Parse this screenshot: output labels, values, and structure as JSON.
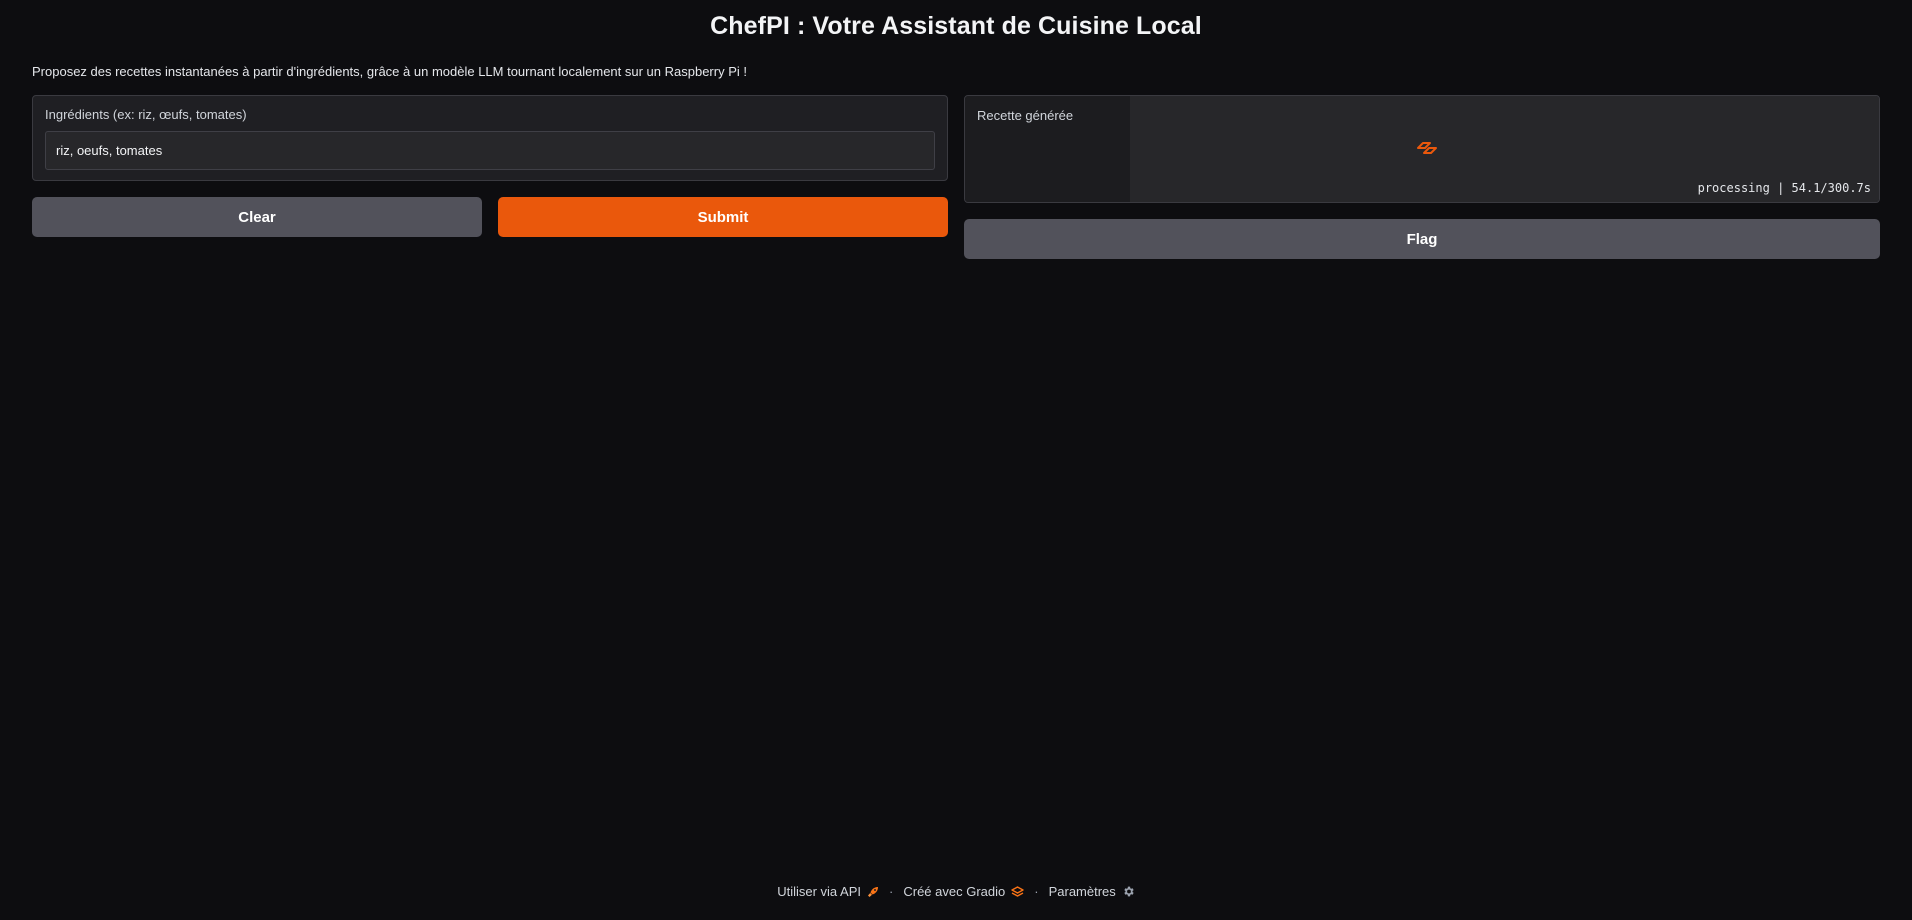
{
  "header": {
    "title": "ChefPI : Votre Assistant de Cuisine Local",
    "description": "Proposez des recettes instantanées à partir d'ingrédients, grâce à un modèle LLM tournant localement sur un Raspberry Pi !"
  },
  "input": {
    "label": "Ingrédients (ex: riz, œufs, tomates)",
    "value": "riz, oeufs, tomates"
  },
  "actions": {
    "clear_label": "Clear",
    "submit_label": "Submit",
    "flag_label": "Flag"
  },
  "output": {
    "label": "Recette générée",
    "status": "processing | 54.1/300.7s"
  },
  "footer": {
    "api_label": "Utiliser via API",
    "gradio_label": "Créé avec Gradio",
    "settings_label": "Paramètres",
    "separator": "·"
  },
  "colors": {
    "accent": "#ea580c",
    "background": "#0d0d10",
    "panel": "#1f1f23",
    "secondary_button": "#52525b"
  },
  "icons": {
    "api": "rocket-icon",
    "gradio": "gradio-logo-icon",
    "settings": "gear-icon",
    "loader": "gradio-loader-icon"
  }
}
